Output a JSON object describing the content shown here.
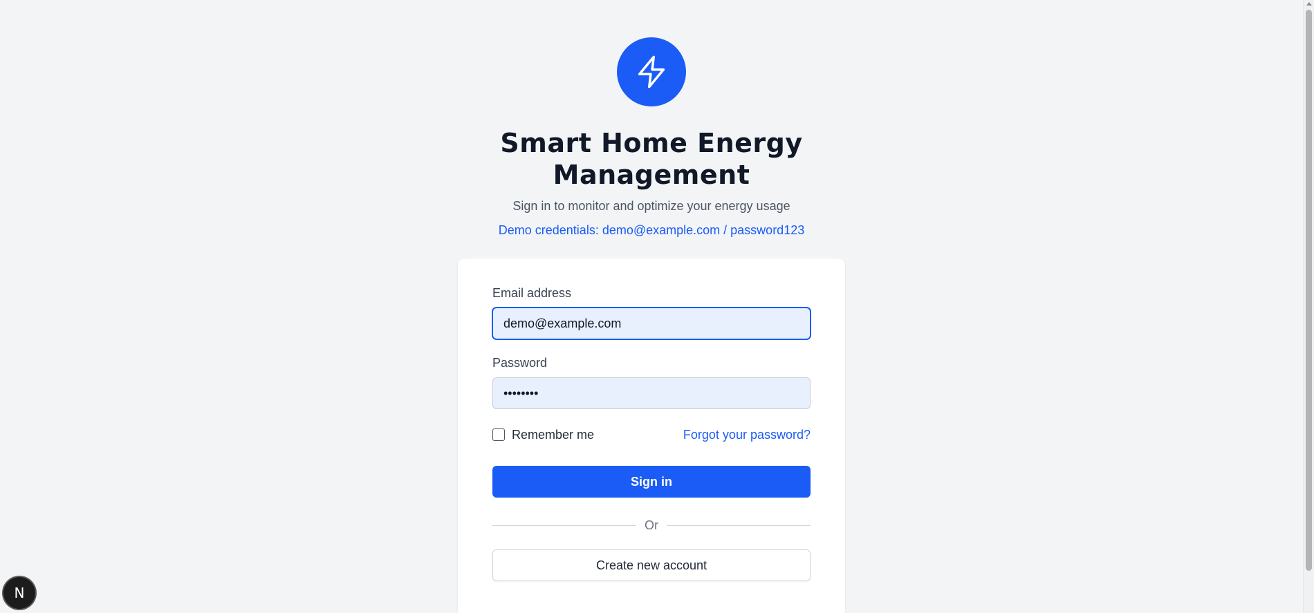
{
  "header": {
    "logo_icon": "lightning-bolt-icon",
    "title": "Smart Home Energy Management",
    "subtitle": "Sign in to monitor and optimize your energy usage",
    "demo_credentials": "Demo credentials: demo@example.com / password123"
  },
  "form": {
    "email_label": "Email address",
    "email_value": "demo@example.com",
    "password_label": "Password",
    "password_value": "password",
    "remember_label": "Remember me",
    "remember_checked": false,
    "forgot_link": "Forgot your password?",
    "signin_label": "Sign in",
    "divider_text": "Or",
    "create_account_label": "Create new account"
  },
  "badge": {
    "letter": "N",
    "icon": "nextjs-logo-icon"
  },
  "colors": {
    "accent": "#1a5cf5",
    "background": "#f3f4f6",
    "card": "#ffffff",
    "input_fill": "#e8f0fe"
  }
}
